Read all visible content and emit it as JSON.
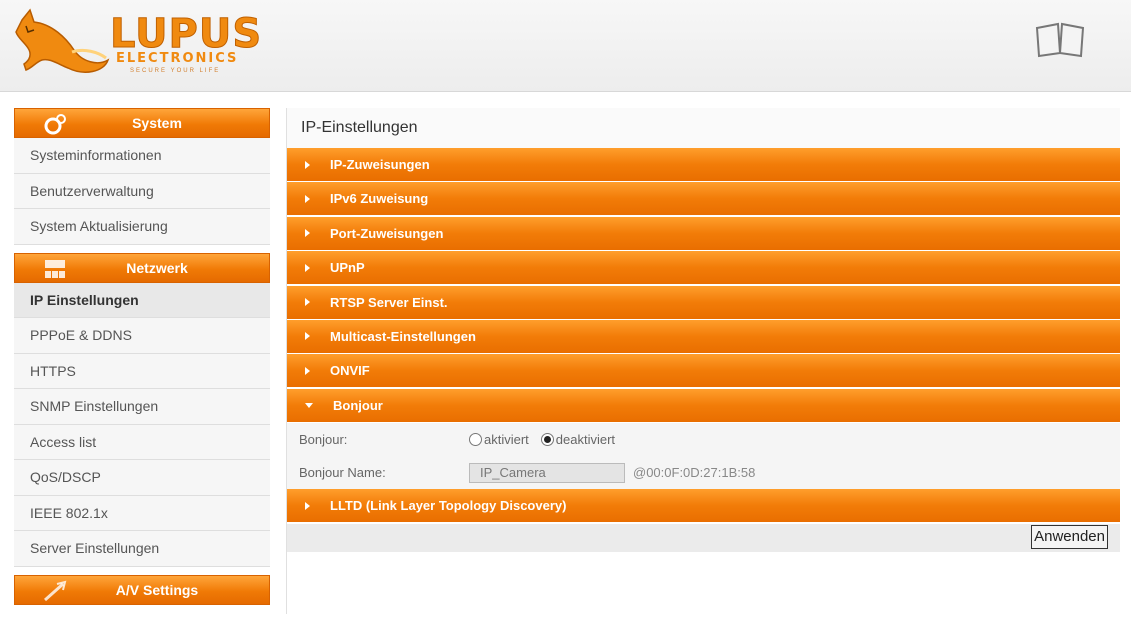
{
  "brand": {
    "name": "LUPUS",
    "sub": "ELECTRONICS",
    "tagline": "SECURE YOUR LIFE",
    "accent": "#f07a06"
  },
  "sidebar": {
    "system": {
      "title": "System",
      "items": [
        "Systeminformationen",
        "Benutzerverwaltung",
        "System Aktualisierung"
      ]
    },
    "netzwerk": {
      "title": "Netzwerk",
      "items": [
        "IP Einstellungen",
        "PPPoE & DDNS",
        "HTTPS",
        "SNMP Einstellungen",
        "Access list",
        "QoS/DSCP",
        "IEEE 802.1x",
        "Server Einstellungen"
      ],
      "active": "IP Einstellungen"
    },
    "av": {
      "title": "A/V Settings"
    }
  },
  "main": {
    "title": "IP-Einstellungen",
    "sections": [
      "IP-Zuweisungen",
      "IPv6 Zuweisung",
      "Port-Zuweisungen",
      "UPnP",
      "RTSP Server Einst.",
      "Multicast-Einstellungen",
      "ONVIF",
      "Bonjour",
      "LLTD (Link Layer Topology Discovery)"
    ],
    "bonjour": {
      "label": "Bonjour:",
      "opt_on": "aktiviert",
      "opt_off": "deaktiviert",
      "selected": "deaktiviert",
      "name_label": "Bonjour Name:",
      "name_value": "IP_Camera",
      "mac": "@00:0F:0D:27:1B:58"
    },
    "apply_label": "Anwenden"
  }
}
